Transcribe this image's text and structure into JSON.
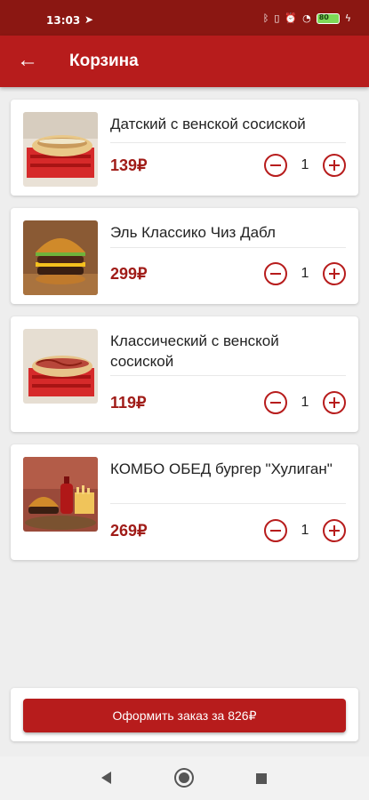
{
  "status_bar": {
    "time": "13:03",
    "icons": [
      "telegram-icon",
      "bluetooth-icon",
      "vibrate-icon",
      "alarm-off-icon",
      "wifi-icon",
      "battery-icon"
    ],
    "battery_level": "80"
  },
  "app_bar": {
    "title": "Корзина",
    "back_icon": "arrow-left-icon"
  },
  "cart_items": [
    {
      "name": "Датский с венской сосиской",
      "price": "139₽",
      "quantity": "1"
    },
    {
      "name": "Эль Классико Чиз Дабл",
      "price": "299₽",
      "quantity": "1"
    },
    {
      "name": "Классический с венской сосиской",
      "price": "119₽",
      "quantity": "1"
    },
    {
      "name": "КОМБО ОБЕД бургер \"Хулиган\"",
      "price": "269₽",
      "quantity": "1"
    }
  ],
  "checkout": {
    "button_label": "Оформить заказ за 826₽"
  },
  "colors": {
    "primary": "#b71c1c",
    "status_bar": "#8b1712",
    "price": "#a01c18",
    "background": "#eeeeee"
  }
}
